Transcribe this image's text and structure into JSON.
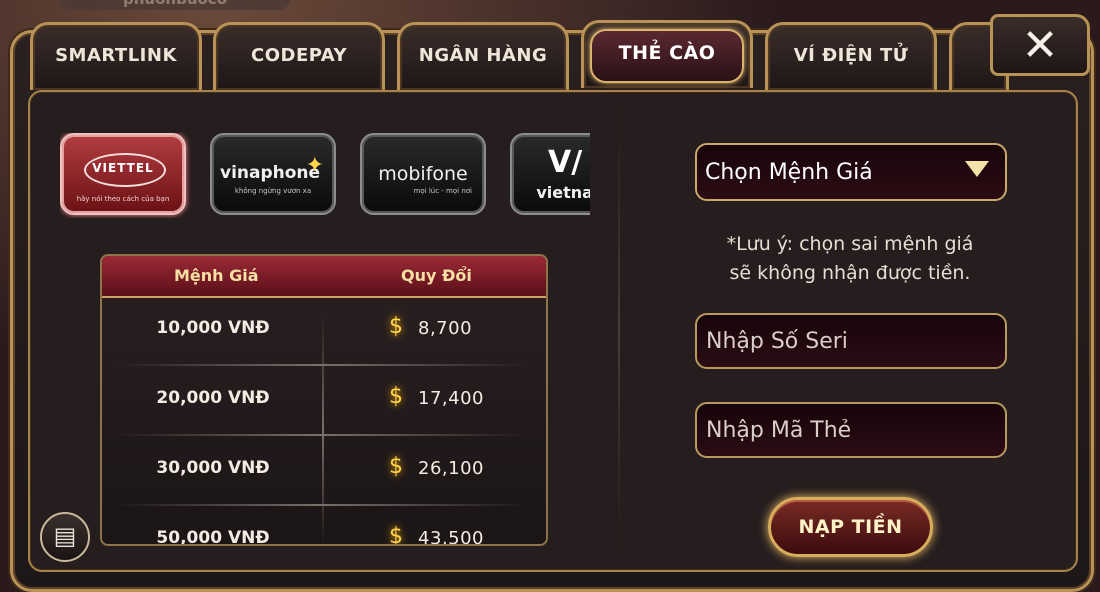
{
  "background": {
    "top_text": "phuonbuoco"
  },
  "tabs": [
    {
      "label": "SMARTLINK",
      "active": false
    },
    {
      "label": "CODEPAY",
      "active": false
    },
    {
      "label": "NGÂN HÀNG",
      "active": false
    },
    {
      "label": "THẺ CÀO",
      "active": true
    },
    {
      "label": "VÍ ĐIỆN TỬ",
      "active": false
    }
  ],
  "carriers": [
    {
      "name": "VIETTEL",
      "slogan": "hãy nói theo cách của bạn",
      "active": true
    },
    {
      "name": "vinaphone",
      "slogan": "không ngừng vươn xa",
      "active": false
    },
    {
      "name": "mobifone",
      "slogan": "mọi lúc - mọi nơi",
      "active": false
    },
    {
      "name": "vietnam",
      "active": false
    }
  ],
  "rate_table": {
    "headers": [
      "Mệnh Giá",
      "Quy Đổi"
    ],
    "currency_symbol": "$",
    "rows": [
      {
        "value": "10,000 VNĐ",
        "amount": "8,700"
      },
      {
        "value": "20,000 VNĐ",
        "amount": "17,400"
      },
      {
        "value": "30,000 VNĐ",
        "amount": "26,100"
      },
      {
        "value": "50,000 VNĐ",
        "amount": "43,500"
      }
    ]
  },
  "form": {
    "denomination_select": "Chọn Mệnh Giá",
    "note_line1": "*Lưu ý: chọn sai mệnh giá",
    "note_line2": "sẽ không nhận được tiền.",
    "serial_placeholder": "Nhập Số Seri",
    "code_placeholder": "Nhập Mã Thẻ",
    "submit_label": "NẠP TIỀN"
  },
  "icons": {
    "close": "close-icon",
    "history": "history-icon",
    "dropdown": "chevron-down-icon",
    "coin": "coin-icon"
  },
  "colors": {
    "gold_border": "#b89256",
    "active_tab": "#5b2830",
    "header_red": "#9b2a37",
    "coin_gold": "#ffd34d"
  }
}
